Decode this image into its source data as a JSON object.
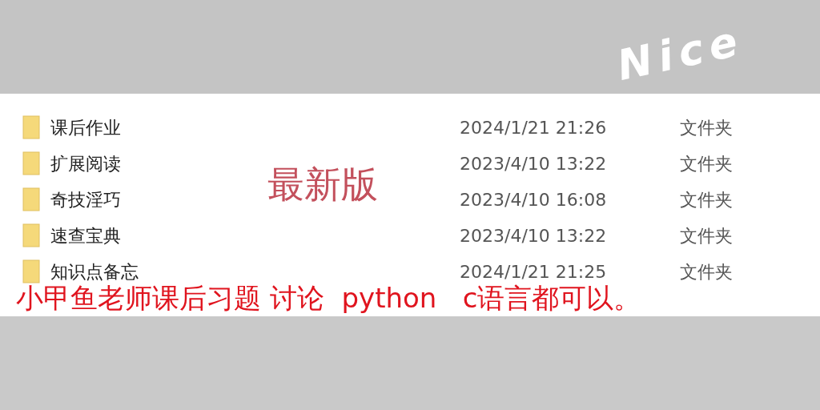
{
  "sticker": {
    "text": "Nice"
  },
  "files": [
    {
      "name": "课后作业",
      "modified": "2024/1/21 21:26",
      "type": "文件夹"
    },
    {
      "name": "扩展阅读",
      "modified": "2023/4/10 13:22",
      "type": "文件夹"
    },
    {
      "name": "奇技淫巧",
      "modified": "2023/4/10 16:08",
      "type": "文件夹"
    },
    {
      "name": "速查宝典",
      "modified": "2023/4/10 13:22",
      "type": "文件夹"
    },
    {
      "name": "知识点备忘",
      "modified": "2024/1/21 21:25",
      "type": "文件夹"
    }
  ],
  "overlay_label": "最新版",
  "caption": "小甲鱼老师课后习题 讨论  python   c语言都可以。"
}
